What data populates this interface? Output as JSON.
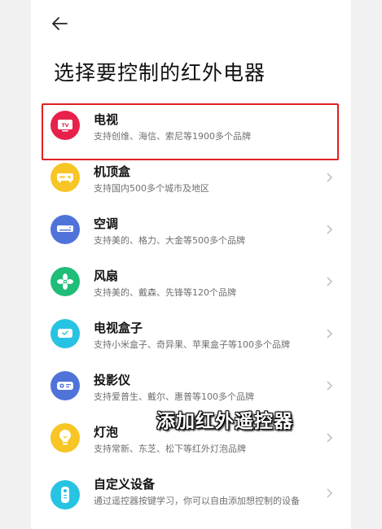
{
  "header": {
    "title": "选择要控制的红外电器"
  },
  "devices": [
    {
      "name": "电视",
      "desc": "支持创维、海信、索尼等1900多个品牌",
      "icon": "tv-icon",
      "color": "#e8214a",
      "has_chevron": false
    },
    {
      "name": "机顶盒",
      "desc": "支持国内500多个城市及地区",
      "icon": "set-top-box-icon",
      "color": "#f7c524",
      "has_chevron": true
    },
    {
      "name": "空调",
      "desc": "支持美的、格力、大金等500多个品牌",
      "icon": "air-conditioner-icon",
      "color": "#4f73d9",
      "has_chevron": true
    },
    {
      "name": "风扇",
      "desc": "支持美的、戴森、先锋等120个品牌",
      "icon": "fan-icon",
      "color": "#1fbd78",
      "has_chevron": true
    },
    {
      "name": "电视盒子",
      "desc": "支持小米盒子、奇异果、苹果盒子等100多个品牌",
      "icon": "tv-box-icon",
      "color": "#27c3e3",
      "has_chevron": true
    },
    {
      "name": "投影仪",
      "desc": "支持爱普生、戴尔、惠普等100多个品牌",
      "icon": "projector-icon",
      "color": "#4f73d9",
      "has_chevron": true
    },
    {
      "name": "灯泡",
      "desc": "支持常新、东芝、松下等红外灯泡品牌",
      "icon": "light-bulb-icon",
      "color": "#f7c524",
      "has_chevron": true
    },
    {
      "name": "自定义设备",
      "desc": "通过遥控器按键学习，你可以自由添加想控制的设备",
      "icon": "remote-control-icon",
      "color": "#27c3e3",
      "has_chevron": true
    }
  ],
  "caption": "添加红外遥控器",
  "highlight_color": "#e0201f"
}
